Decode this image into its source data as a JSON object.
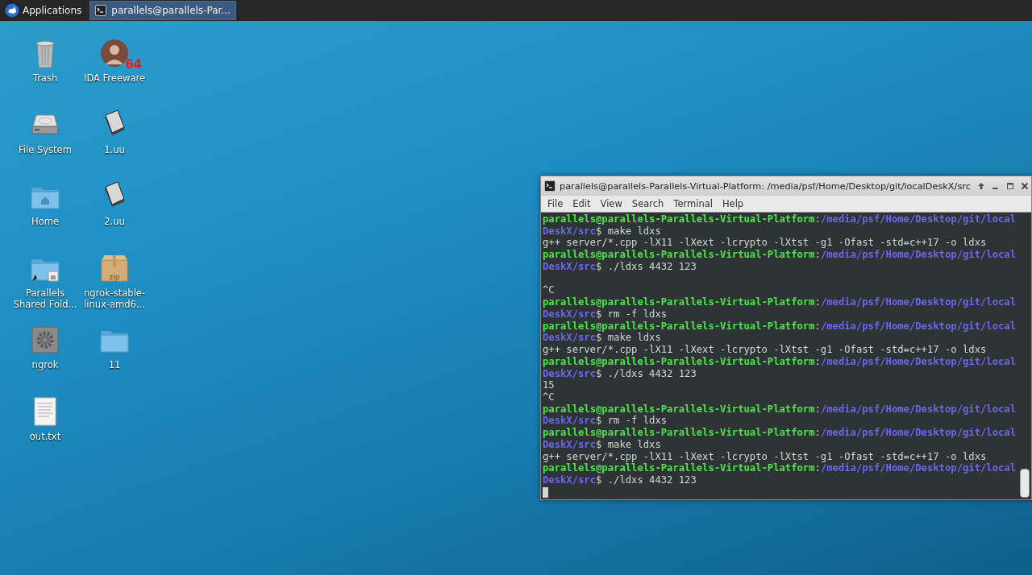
{
  "top_panel": {
    "applications_label": "Applications",
    "tasks": [
      {
        "title": "parallels@parallels-Par...",
        "selected": true
      }
    ]
  },
  "desktop_icons": [
    {
      "label": "Trash",
      "kind": "trash"
    },
    {
      "label": "File System",
      "kind": "drive"
    },
    {
      "label": "Home",
      "kind": "home-folder"
    },
    {
      "label": "Parallels Shared Fold...",
      "kind": "shared-folder"
    },
    {
      "label": "ngrok",
      "kind": "settings"
    },
    {
      "label": "out.txt",
      "kind": "text-file"
    },
    {
      "label": "IDA Freeware",
      "kind": "portrait",
      "badge": "64"
    },
    {
      "label": "1.uu",
      "kind": "document"
    },
    {
      "label": "2.uu",
      "kind": "document"
    },
    {
      "label": "ngrok-stable-linux-amd6...",
      "kind": "archive",
      "badge": "zip"
    },
    {
      "label": "11",
      "kind": "folder"
    }
  ],
  "terminal_window": {
    "title": "parallels@parallels-Parallels-Virtual-Platform: /media/psf/Home/Desktop/git/localDeskX/src",
    "menu": [
      "File",
      "Edit",
      "View",
      "Search",
      "Terminal",
      "Help"
    ],
    "lines": [
      {
        "kind": "text",
        "segments": [
          {
            "kind": "user",
            "text": "parallels@parallels-Parallels-Virtual-Platform"
          },
          {
            "kind": "plain",
            "text": ":"
          },
          {
            "kind": "path",
            "text": "/media/psf/Home/Desktop/git/local"
          }
        ]
      },
      {
        "kind": "text",
        "segments": [
          {
            "kind": "path",
            "text": "DeskX/src"
          },
          {
            "kind": "plain",
            "text": "$ make ldxs"
          }
        ]
      },
      {
        "kind": "text",
        "segments": [
          {
            "kind": "plain",
            "text": "g++ server/*.cpp -lX11 -lXext -lcrypto -lXtst -g1 -Ofast -std=c++17 -o ldxs"
          }
        ]
      },
      {
        "kind": "text",
        "segments": [
          {
            "kind": "user",
            "text": "parallels@parallels-Parallels-Virtual-Platform"
          },
          {
            "kind": "plain",
            "text": ":"
          },
          {
            "kind": "path",
            "text": "/media/psf/Home/Desktop/git/local"
          }
        ]
      },
      {
        "kind": "text",
        "segments": [
          {
            "kind": "path",
            "text": "DeskX/src"
          },
          {
            "kind": "plain",
            "text": "$ ./ldxs 4432 123"
          }
        ]
      },
      {
        "kind": "blank"
      },
      {
        "kind": "text",
        "segments": [
          {
            "kind": "plain",
            "text": "^C"
          }
        ]
      },
      {
        "kind": "text",
        "segments": [
          {
            "kind": "user",
            "text": "parallels@parallels-Parallels-Virtual-Platform"
          },
          {
            "kind": "plain",
            "text": ":"
          },
          {
            "kind": "path",
            "text": "/media/psf/Home/Desktop/git/local"
          }
        ]
      },
      {
        "kind": "text",
        "segments": [
          {
            "kind": "path",
            "text": "DeskX/src"
          },
          {
            "kind": "plain",
            "text": "$ rm -f ldxs"
          }
        ]
      },
      {
        "kind": "text",
        "segments": [
          {
            "kind": "user",
            "text": "parallels@parallels-Parallels-Virtual-Platform"
          },
          {
            "kind": "plain",
            "text": ":"
          },
          {
            "kind": "path",
            "text": "/media/psf/Home/Desktop/git/local"
          }
        ]
      },
      {
        "kind": "text",
        "segments": [
          {
            "kind": "path",
            "text": "DeskX/src"
          },
          {
            "kind": "plain",
            "text": "$ make ldxs"
          }
        ]
      },
      {
        "kind": "text",
        "segments": [
          {
            "kind": "plain",
            "text": "g++ server/*.cpp -lX11 -lXext -lcrypto -lXtst -g1 -Ofast -std=c++17 -o ldxs"
          }
        ]
      },
      {
        "kind": "text",
        "segments": [
          {
            "kind": "user",
            "text": "parallels@parallels-Parallels-Virtual-Platform"
          },
          {
            "kind": "plain",
            "text": ":"
          },
          {
            "kind": "path",
            "text": "/media/psf/Home/Desktop/git/local"
          }
        ]
      },
      {
        "kind": "text",
        "segments": [
          {
            "kind": "path",
            "text": "DeskX/src"
          },
          {
            "kind": "plain",
            "text": "$ ./ldxs 4432 123"
          }
        ]
      },
      {
        "kind": "text",
        "segments": [
          {
            "kind": "plain",
            "text": "15"
          }
        ]
      },
      {
        "kind": "text",
        "segments": [
          {
            "kind": "plain",
            "text": "^C"
          }
        ]
      },
      {
        "kind": "text",
        "segments": [
          {
            "kind": "user",
            "text": "parallels@parallels-Parallels-Virtual-Platform"
          },
          {
            "kind": "plain",
            "text": ":"
          },
          {
            "kind": "path",
            "text": "/media/psf/Home/Desktop/git/local"
          }
        ]
      },
      {
        "kind": "text",
        "segments": [
          {
            "kind": "path",
            "text": "DeskX/src"
          },
          {
            "kind": "plain",
            "text": "$ rm -f ldxs"
          }
        ]
      },
      {
        "kind": "text",
        "segments": [
          {
            "kind": "user",
            "text": "parallels@parallels-Parallels-Virtual-Platform"
          },
          {
            "kind": "plain",
            "text": ":"
          },
          {
            "kind": "path",
            "text": "/media/psf/Home/Desktop/git/local"
          }
        ]
      },
      {
        "kind": "text",
        "segments": [
          {
            "kind": "path",
            "text": "DeskX/src"
          },
          {
            "kind": "plain",
            "text": "$ make ldxs"
          }
        ]
      },
      {
        "kind": "text",
        "segments": [
          {
            "kind": "plain",
            "text": "g++ server/*.cpp -lX11 -lXext -lcrypto -lXtst -g1 -Ofast -std=c++17 -o ldxs"
          }
        ]
      },
      {
        "kind": "text",
        "segments": [
          {
            "kind": "user",
            "text": "parallels@parallels-Parallels-Virtual-Platform"
          },
          {
            "kind": "plain",
            "text": ":"
          },
          {
            "kind": "path",
            "text": "/media/psf/Home/Desktop/git/local"
          }
        ]
      },
      {
        "kind": "text",
        "segments": [
          {
            "kind": "path",
            "text": "DeskX/src"
          },
          {
            "kind": "plain",
            "text": "$ ./ldxs 4432 123"
          }
        ]
      },
      {
        "kind": "cursor"
      }
    ]
  }
}
